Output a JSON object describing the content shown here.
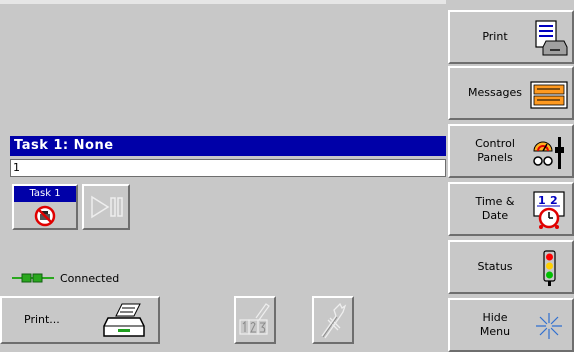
{
  "task": {
    "title": "Task 1: None",
    "input_value": "1",
    "tile_label": "Task 1"
  },
  "status": {
    "connection_label": "Connected"
  },
  "print_button": {
    "label": "Print..."
  },
  "side_menu": {
    "items": [
      {
        "label": "Print",
        "icon": "printer-document-icon"
      },
      {
        "label": "Messages",
        "icon": "messages-icon"
      },
      {
        "label": "Control\nPanels",
        "icon": "control-panels-icon"
      },
      {
        "label": "Time &\nDate",
        "icon": "clock-calendar-icon"
      },
      {
        "label": "Status",
        "icon": "traffic-light-icon"
      },
      {
        "label": "Hide\nMenu",
        "icon": "sparkle-icon"
      }
    ]
  },
  "colors": {
    "background": "#c8c8c8",
    "title_bar": "#0000a8",
    "connected": "#2aa81e"
  }
}
